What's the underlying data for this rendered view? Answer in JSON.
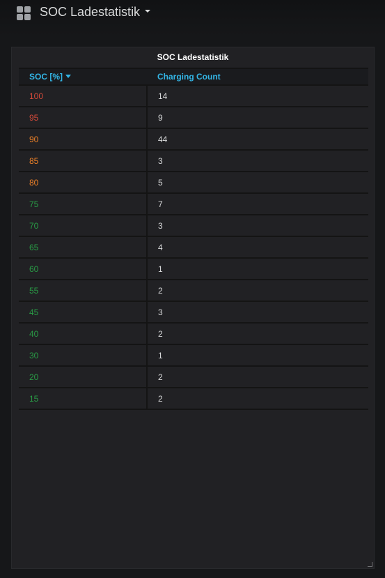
{
  "dashboard": {
    "title": "SOC Ladestatistik"
  },
  "panel": {
    "title": "SOC Ladestatistik",
    "columns": [
      "SOC [%]",
      "Charging Count"
    ],
    "sort": "descending",
    "rows": [
      {
        "soc": "100",
        "count": "14",
        "color": "#d44a3a"
      },
      {
        "soc": "95",
        "count": "9",
        "color": "#d44a3a"
      },
      {
        "soc": "90",
        "count": "44",
        "color": "#ed8128"
      },
      {
        "soc": "85",
        "count": "3",
        "color": "#ed8128"
      },
      {
        "soc": "80",
        "count": "5",
        "color": "#ed8128"
      },
      {
        "soc": "75",
        "count": "7",
        "color": "#299c46"
      },
      {
        "soc": "70",
        "count": "3",
        "color": "#299c46"
      },
      {
        "soc": "65",
        "count": "4",
        "color": "#299c46"
      },
      {
        "soc": "60",
        "count": "1",
        "color": "#299c46"
      },
      {
        "soc": "55",
        "count": "2",
        "color": "#299c46"
      },
      {
        "soc": "45",
        "count": "3",
        "color": "#299c46"
      },
      {
        "soc": "40",
        "count": "2",
        "color": "#299c46"
      },
      {
        "soc": "30",
        "count": "1",
        "color": "#299c46"
      },
      {
        "soc": "20",
        "count": "2",
        "color": "#299c46"
      },
      {
        "soc": "15",
        "count": "2",
        "color": "#299c46"
      }
    ]
  },
  "colors": {
    "header_link": "#33b5e5",
    "red": "#d44a3a",
    "orange": "#ed8128",
    "green": "#299c46"
  }
}
